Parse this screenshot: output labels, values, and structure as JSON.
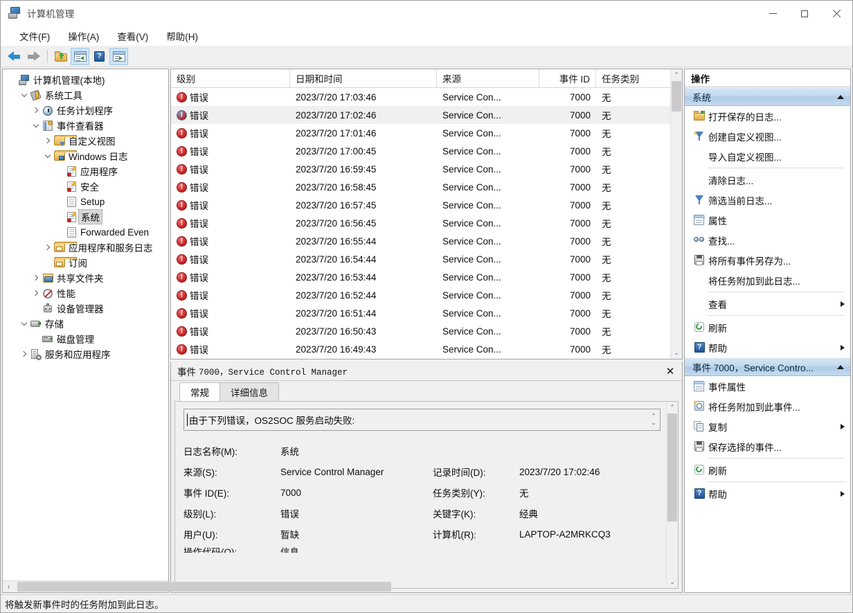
{
  "window": {
    "title": "计算机管理",
    "icon": "computer-management-icon",
    "minimize_label": "最小化",
    "maximize_label": "最大化",
    "close_label": "关闭"
  },
  "menubar": {
    "items": [
      {
        "label": "文件(F)"
      },
      {
        "label": "操作(A)"
      },
      {
        "label": "查看(V)"
      },
      {
        "label": "帮助(H)"
      }
    ]
  },
  "toolbar": {
    "buttons": [
      {
        "name": "back-button",
        "icon": "back-arrow-icon",
        "active": false
      },
      {
        "name": "forward-button",
        "icon": "forward-arrow-icon",
        "active": false
      },
      {
        "name": "up-one-level-button",
        "icon": "folder-up-icon",
        "active": false
      },
      {
        "name": "show-hide-tree-button",
        "icon": "panel-left-icon",
        "active": true
      },
      {
        "name": "help-button",
        "icon": "help-icon",
        "active": false
      },
      {
        "name": "show-hide-actions-button",
        "icon": "panel-right-icon",
        "active": true
      }
    ]
  },
  "tree": {
    "nodes": [
      {
        "label": "计算机管理(本地)",
        "indent": 0,
        "twisty": "none",
        "icon": "computer-icon",
        "selected": false
      },
      {
        "label": "系统工具",
        "indent": 1,
        "twisty": "open",
        "icon": "system-tools-icon",
        "selected": false
      },
      {
        "label": "任务计划程序",
        "indent": 2,
        "twisty": "closed",
        "icon": "task-scheduler-icon",
        "selected": false
      },
      {
        "label": "事件查看器",
        "indent": 2,
        "twisty": "open",
        "icon": "event-viewer-icon",
        "selected": false
      },
      {
        "label": "自定义视图",
        "indent": 3,
        "twisty": "closed",
        "icon": "custom-views-icon",
        "selected": false
      },
      {
        "label": "Windows 日志",
        "indent": 3,
        "twisty": "open",
        "icon": "windows-logs-icon",
        "selected": false
      },
      {
        "label": "应用程序",
        "indent": 4,
        "twisty": "none",
        "icon": "log-warning-icon",
        "selected": false
      },
      {
        "label": "安全",
        "indent": 4,
        "twisty": "none",
        "icon": "log-warning-icon",
        "selected": false
      },
      {
        "label": "Setup",
        "indent": 4,
        "twisty": "none",
        "icon": "log-plain-icon",
        "selected": false
      },
      {
        "label": "系统",
        "indent": 4,
        "twisty": "none",
        "icon": "log-warning-icon",
        "selected": true
      },
      {
        "label": "Forwarded Even",
        "indent": 4,
        "twisty": "none",
        "icon": "log-plain-icon",
        "selected": false
      },
      {
        "label": "应用程序和服务日志",
        "indent": 3,
        "twisty": "closed",
        "icon": "app-service-logs-icon",
        "selected": false
      },
      {
        "label": "订阅",
        "indent": 3,
        "twisty": "none",
        "icon": "subscriptions-icon",
        "selected": false
      },
      {
        "label": "共享文件夹",
        "indent": 2,
        "twisty": "closed",
        "icon": "shared-folders-icon",
        "selected": false
      },
      {
        "label": "性能",
        "indent": 2,
        "twisty": "closed",
        "icon": "performance-icon",
        "selected": false
      },
      {
        "label": "设备管理器",
        "indent": 2,
        "twisty": "none",
        "icon": "device-manager-icon",
        "selected": false
      },
      {
        "label": "存储",
        "indent": 1,
        "twisty": "open",
        "icon": "storage-icon",
        "selected": false
      },
      {
        "label": "磁盘管理",
        "indent": 2,
        "twisty": "none",
        "icon": "disk-management-icon",
        "selected": false
      },
      {
        "label": "服务和应用程序",
        "indent": 1,
        "twisty": "closed",
        "icon": "services-apps-icon",
        "selected": false
      }
    ],
    "hscroll": {
      "left_arrow": "‹",
      "right_arrow": "›"
    }
  },
  "event_list": {
    "columns": [
      {
        "label": "级别",
        "key": "level",
        "align": "left"
      },
      {
        "label": "日期和时间",
        "key": "date",
        "align": "left"
      },
      {
        "label": "来源",
        "key": "source",
        "align": "left"
      },
      {
        "label": "事件 ID",
        "key": "id",
        "align": "right"
      },
      {
        "label": "任务类别",
        "key": "task",
        "align": "left"
      }
    ],
    "rows": [
      {
        "level": "错误",
        "date": "2023/7/20 17:03:46",
        "source": "Service Con...",
        "id": "7000",
        "task": "无",
        "selected": false
      },
      {
        "level": "错误",
        "date": "2023/7/20 17:02:46",
        "source": "Service Con...",
        "id": "7000",
        "task": "无",
        "selected": true
      },
      {
        "level": "错误",
        "date": "2023/7/20 17:01:46",
        "source": "Service Con...",
        "id": "7000",
        "task": "无",
        "selected": false
      },
      {
        "level": "错误",
        "date": "2023/7/20 17:00:45",
        "source": "Service Con...",
        "id": "7000",
        "task": "无",
        "selected": false
      },
      {
        "level": "错误",
        "date": "2023/7/20 16:59:45",
        "source": "Service Con...",
        "id": "7000",
        "task": "无",
        "selected": false
      },
      {
        "level": "错误",
        "date": "2023/7/20 16:58:45",
        "source": "Service Con...",
        "id": "7000",
        "task": "无",
        "selected": false
      },
      {
        "level": "错误",
        "date": "2023/7/20 16:57:45",
        "source": "Service Con...",
        "id": "7000",
        "task": "无",
        "selected": false
      },
      {
        "level": "错误",
        "date": "2023/7/20 16:56:45",
        "source": "Service Con...",
        "id": "7000",
        "task": "无",
        "selected": false
      },
      {
        "level": "错误",
        "date": "2023/7/20 16:55:44",
        "source": "Service Con...",
        "id": "7000",
        "task": "无",
        "selected": false
      },
      {
        "level": "错误",
        "date": "2023/7/20 16:54:44",
        "source": "Service Con...",
        "id": "7000",
        "task": "无",
        "selected": false
      },
      {
        "level": "错误",
        "date": "2023/7/20 16:53:44",
        "source": "Service Con...",
        "id": "7000",
        "task": "无",
        "selected": false
      },
      {
        "level": "错误",
        "date": "2023/7/20 16:52:44",
        "source": "Service Con...",
        "id": "7000",
        "task": "无",
        "selected": false
      },
      {
        "level": "错误",
        "date": "2023/7/20 16:51:44",
        "source": "Service Con...",
        "id": "7000",
        "task": "无",
        "selected": false
      },
      {
        "level": "错误",
        "date": "2023/7/20 16:50:43",
        "source": "Service Con...",
        "id": "7000",
        "task": "无",
        "selected": false
      },
      {
        "level": "错误",
        "date": "2023/7/20 16:49:43",
        "source": "Service Con...",
        "id": "7000",
        "task": "无",
        "selected": false
      }
    ]
  },
  "detail": {
    "header_prefix": "事件",
    "header_value": "7000，Service Control Manager",
    "close_glyph": "✕",
    "tabs": [
      {
        "label": "常规",
        "active": true
      },
      {
        "label": "详细信息",
        "active": false
      }
    ],
    "message": "由于下列错误，OS2SOC 服务启动失败:",
    "fields": [
      {
        "label": "日志名称(M):",
        "value": "系统",
        "label2": "",
        "value2": ""
      },
      {
        "label": "来源(S):",
        "value": "Service Control Manager",
        "label2": "记录时间(D):",
        "value2": "2023/7/20 17:02:46"
      },
      {
        "label": "事件 ID(E):",
        "value": "7000",
        "label2": "任务类别(Y):",
        "value2": "无"
      },
      {
        "label": "级别(L):",
        "value": "错误",
        "label2": "关键字(K):",
        "value2": "经典"
      },
      {
        "label": "用户(U):",
        "value": "暂缺",
        "label2": "计算机(R):",
        "value2": "LAPTOP-A2MRKCQ3"
      },
      {
        "label": "操作代码(O):",
        "value": "信息",
        "label2": "",
        "value2": ""
      }
    ]
  },
  "actions": {
    "title": "操作",
    "groups": [
      {
        "name": "system-group",
        "header": "系统",
        "collapse_icon": "caret-up-icon",
        "items": [
          {
            "label": "打开保存的日志...",
            "icon": "open-saved-log-icon",
            "submenu": false,
            "separator_after": false
          },
          {
            "label": "创建自定义视图...",
            "icon": "create-custom-view-icon",
            "submenu": false,
            "separator_after": false
          },
          {
            "label": "导入自定义视图...",
            "icon": "none",
            "submenu": false,
            "separator_after": true
          },
          {
            "label": "清除日志...",
            "icon": "none",
            "submenu": false,
            "separator_after": false
          },
          {
            "label": "筛选当前日志...",
            "icon": "filter-icon",
            "submenu": false,
            "separator_after": false
          },
          {
            "label": "属性",
            "icon": "properties-icon",
            "submenu": false,
            "separator_after": false
          },
          {
            "label": "查找...",
            "icon": "find-icon",
            "submenu": false,
            "separator_after": false
          },
          {
            "label": "将所有事件另存为...",
            "icon": "save-icon",
            "submenu": false,
            "separator_after": false
          },
          {
            "label": "将任务附加到此日志...",
            "icon": "none",
            "submenu": false,
            "separator_after": true
          },
          {
            "label": "查看",
            "icon": "none",
            "submenu": true,
            "separator_after": true
          },
          {
            "label": "刷新",
            "icon": "refresh-icon",
            "submenu": false,
            "separator_after": false
          },
          {
            "label": "帮助",
            "icon": "help-icon",
            "submenu": true,
            "separator_after": false
          }
        ]
      },
      {
        "name": "event-group",
        "header": "事件 7000，Service Contro...",
        "collapse_icon": "caret-up-icon",
        "items": [
          {
            "label": "事件属性",
            "icon": "event-properties-icon",
            "submenu": false,
            "separator_after": false
          },
          {
            "label": "将任务附加到此事件...",
            "icon": "attach-task-icon",
            "submenu": false,
            "separator_after": false
          },
          {
            "label": "复制",
            "icon": "copy-icon",
            "submenu": true,
            "separator_after": false
          },
          {
            "label": "保存选择的事件...",
            "icon": "save-icon",
            "submenu": false,
            "separator_after": true
          },
          {
            "label": "刷新",
            "icon": "refresh-icon",
            "submenu": false,
            "separator_after": true
          },
          {
            "label": "帮助",
            "icon": "help-icon",
            "submenu": true,
            "separator_after": false
          }
        ]
      }
    ]
  },
  "statusbar": {
    "text": "将触发新事件时的任务附加到此日志。"
  },
  "colors": {
    "error_red": "#c41f1f",
    "accent_blue": "#2e8bd0",
    "selection_gray": "#f0f0f0",
    "group_header_blue": "#bfd8ef"
  }
}
